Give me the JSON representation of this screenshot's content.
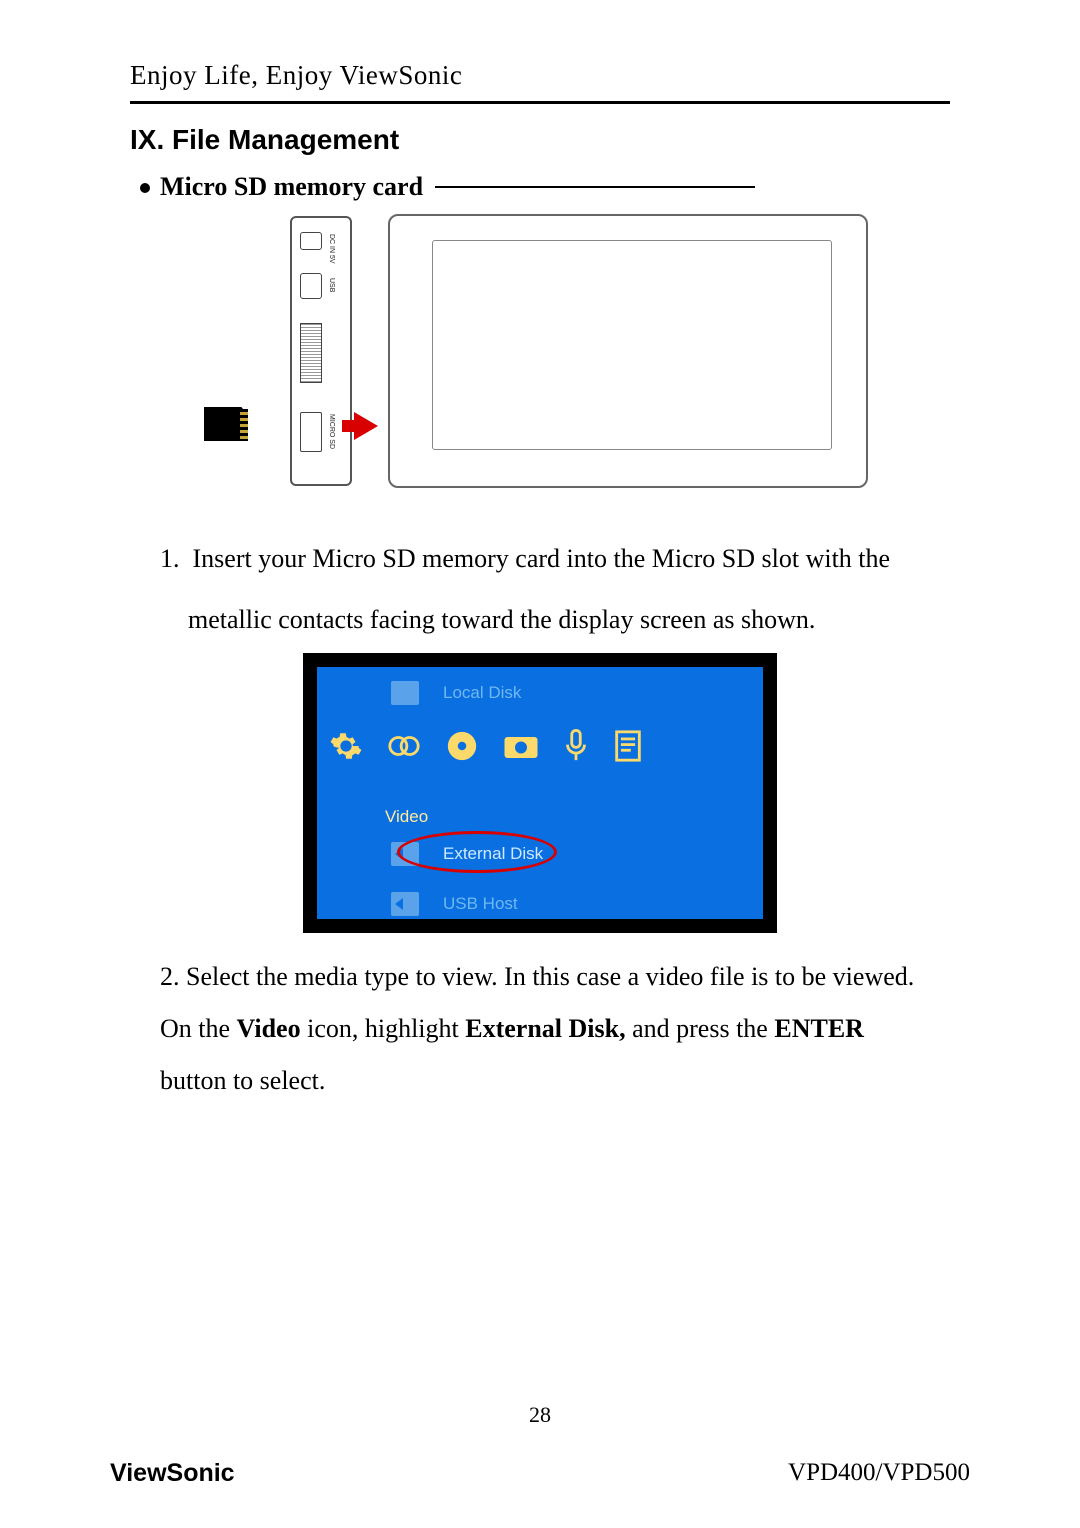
{
  "header": {
    "tagline": "Enjoy Life, Enjoy ViewSonic"
  },
  "section": {
    "title": "IX. File Management"
  },
  "sub": {
    "title": "Micro SD memory card"
  },
  "device": {
    "label_dcin": "DC IN 5V",
    "label_usb": "USB",
    "label_microsd": "MICRO SD"
  },
  "steps": {
    "s1_num": "1.",
    "s1a": "Insert your Micro SD memory card into the Micro SD slot with the",
    "s1b": "metallic contacts facing toward the display screen as shown.",
    "s2_num": "2.",
    "s2a": "Select the media type to view.    In this case a video file is to be viewed.",
    "s2b_pre": "On the ",
    "s2b_bold1": "Video",
    "s2b_mid": " icon, highlight ",
    "s2b_bold2": "External Disk,",
    "s2b_mid2": " and press the ",
    "s2b_bold3": "ENTER",
    "s2c": "button to select."
  },
  "screenshot": {
    "local_disk": "Local Disk",
    "video_label": "Video",
    "external_disk": "External Disk",
    "usb_host": "USB Host"
  },
  "footer": {
    "page_num": "28",
    "brand": "ViewSonic",
    "model": "VPD400/VPD500"
  }
}
